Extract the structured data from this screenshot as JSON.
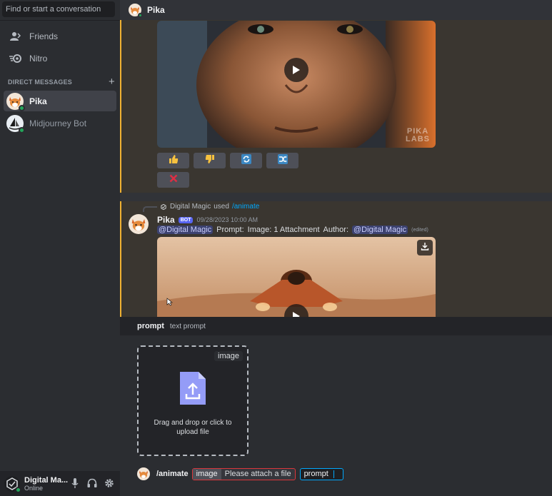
{
  "sidebar": {
    "search_placeholder": "Find or start a conversation",
    "nav": [
      {
        "label": "Friends",
        "icon": "friends-icon"
      },
      {
        "label": "Nitro",
        "icon": "nitro-icon"
      }
    ],
    "dm_header": "DIRECT MESSAGES",
    "dms": [
      {
        "label": "Pika",
        "active": true
      },
      {
        "label": "Midjourney Bot",
        "active": false
      }
    ],
    "user": {
      "name": "Digital Ma...",
      "status": "Online"
    }
  },
  "header": {
    "title": "Pika"
  },
  "video1": {
    "watermark_line1": "PIKA",
    "watermark_line2": "LABS"
  },
  "message": {
    "used_by": "Digital Magic",
    "used_text": "used",
    "command": "/animate",
    "author": "Pika",
    "bot_tag": "BOT",
    "timestamp": "09/28/2023 10:00 AM",
    "mention": "@Digital Magic",
    "prompt_label": "Prompt:",
    "image_text": "Image: 1 Attachment",
    "author_label": "Author:",
    "author_mention": "@Digital Magic",
    "edited": "(edited)"
  },
  "command_panel": {
    "option": "prompt",
    "description": "text prompt",
    "dropzone_tag": "image",
    "dropzone_text": "Drag and drop or click to upload file",
    "command": "/animate",
    "chip_key": "image",
    "chip_error": "Please attach a file",
    "focus_key": "prompt"
  },
  "colors": {
    "accent": "#5865f2",
    "highlight_border": "#f0b232",
    "online": "#23a55a",
    "error": "#da373c",
    "focus": "#00a8fc"
  }
}
